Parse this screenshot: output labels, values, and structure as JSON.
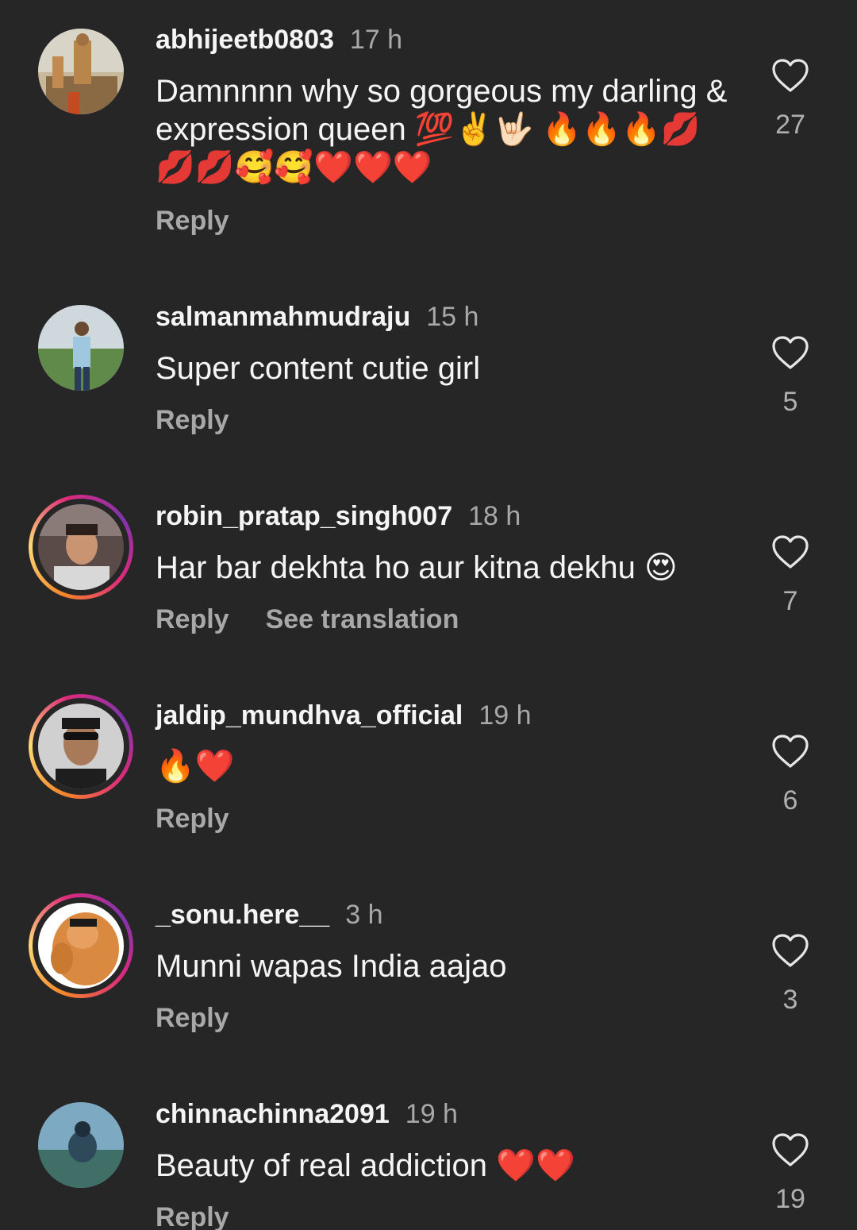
{
  "comments": [
    {
      "username": "abhijeetb0803",
      "time": "17 h",
      "text": "Damnnnn why so gorgeous my darling & expression queen 💯✌️🤟🏻 🔥🔥🔥💋💋💋🥰🥰❤️❤️❤️",
      "reply_label": "Reply",
      "like_count": "27",
      "heart_icon": "heart-outline-icon"
    },
    {
      "username": "salmanmahmudraju",
      "time": "15 h",
      "text": "Super content cutie girl",
      "reply_label": "Reply",
      "like_count": "5",
      "heart_icon": "heart-outline-icon"
    },
    {
      "username": "robin_pratap_singh007",
      "time": "18 h",
      "text": "Har bar dekhta ho aur kitna dekhu 😍",
      "reply_label": "Reply",
      "translation_label": "See translation",
      "like_count": "7",
      "heart_icon": "heart-outline-icon"
    },
    {
      "username": "jaldip_mundhva_official",
      "time": "19 h",
      "text": "🔥❤️",
      "reply_label": "Reply",
      "like_count": "6",
      "heart_icon": "heart-outline-icon"
    },
    {
      "username": "_sonu.here__",
      "time": "3 h",
      "text": "Munni wapas India aajao",
      "reply_label": "Reply",
      "like_count": "3",
      "heart_icon": "heart-outline-icon"
    },
    {
      "username": "chinnachinna2091",
      "time": "19 h",
      "text": "Beauty of real addiction ❤️❤️",
      "reply_label": "Reply",
      "like_count": "19",
      "heart_icon": "heart-outline-icon"
    }
  ]
}
